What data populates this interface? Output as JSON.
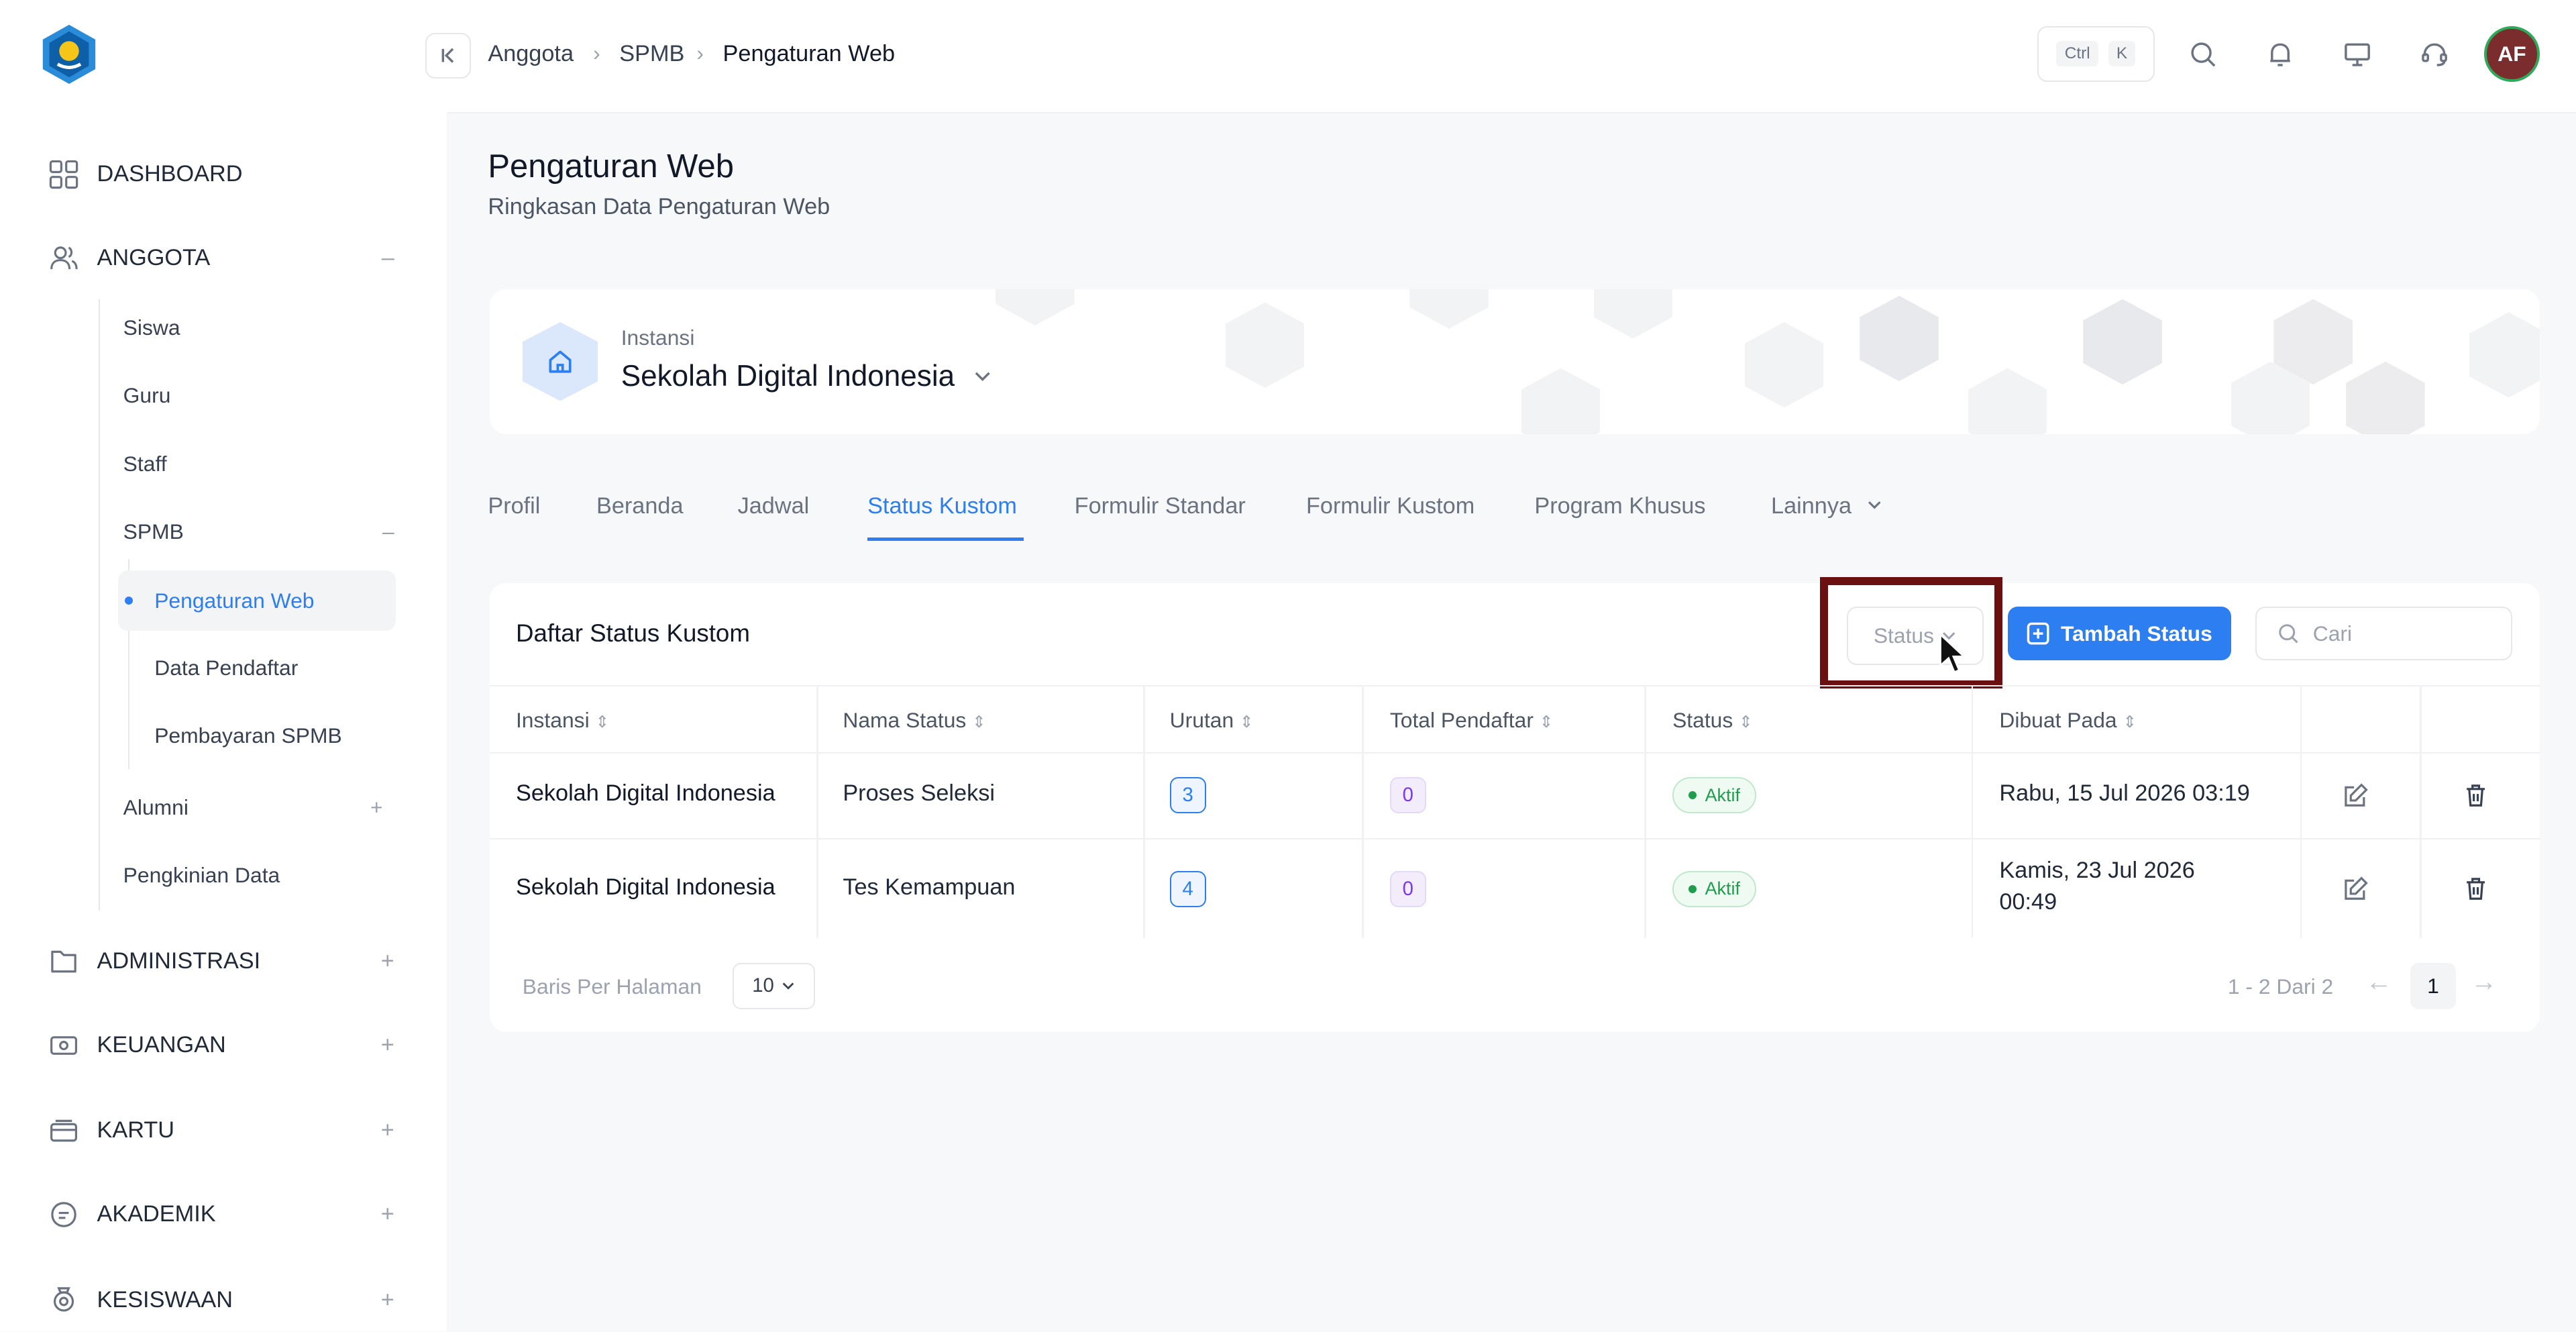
{
  "breadcrumb": [
    "Anggota",
    "SPMB",
    "Pengaturan Web"
  ],
  "topbar": {
    "kbd_ctrl": "Ctrl",
    "kbd_k": "K",
    "avatar_initials": "AF",
    "avatar_color": "#7b2c2c"
  },
  "sidebar": {
    "items": [
      {
        "label": "DASHBOARD",
        "icon": "grid-icon"
      },
      {
        "label": "ANGGOTA",
        "icon": "users-icon",
        "toggle": "–"
      },
      {
        "label": "ADMINISTRASI",
        "icon": "folder-icon",
        "toggle": "+"
      },
      {
        "label": "KEUANGAN",
        "icon": "money-icon",
        "toggle": "+"
      },
      {
        "label": "KARTU",
        "icon": "card-icon",
        "toggle": "+"
      },
      {
        "label": "AKADEMIK",
        "icon": "book-icon",
        "toggle": "+"
      },
      {
        "label": "KESISWAAN",
        "icon": "badge-icon",
        "toggle": "+"
      }
    ],
    "anggota_sub": [
      "Siswa",
      "Guru",
      "Staff",
      "SPMB",
      "Alumni",
      "Pengkinian Data"
    ],
    "spmb_toggle": "–",
    "alumni_toggle": "+",
    "spmb_sub": [
      "Pengaturan Web",
      "Data Pendaftar",
      "Pembayaran SPMB"
    ]
  },
  "page": {
    "title": "Pengaturan Web",
    "subtitle": "Ringkasan Data Pengaturan Web"
  },
  "instansi": {
    "label": "Instansi",
    "name": "Sekolah Digital Indonesia"
  },
  "tabs": [
    "Profil",
    "Beranda",
    "Jadwal",
    "Status Kustom",
    "Formulir Standar",
    "Formulir Kustom",
    "Program Khusus",
    "Lainnya"
  ],
  "active_tab": "Status Kustom",
  "accent_color": "#2d7ef0",
  "table_card": {
    "title": "Daftar Status Kustom",
    "status_filter": "Status",
    "add_button": "Tambah Status",
    "search_placeholder": "Cari",
    "columns": [
      "Instansi",
      "Nama Status",
      "Urutan",
      "Total Pendaftar",
      "Status",
      "Dibuat Pada"
    ],
    "rows": [
      {
        "instansi": "Sekolah Digital Indonesia",
        "nama": "Proses Seleksi",
        "urutan": "3",
        "total": "0",
        "status": "Aktif",
        "dibuat_1": "Rabu, 15 Jul 2026 03:19",
        "dibuat_2": ""
      },
      {
        "instansi": "Sekolah Digital Indonesia",
        "nama": "Tes Kemampuan",
        "urutan": "4",
        "total": "0",
        "status": "Aktif",
        "dibuat_1": "Kamis, 23 Jul 2026",
        "dibuat_2": "00:49"
      }
    ],
    "per_page_label": "Baris Per Halaman",
    "per_page": "10",
    "page_info": "1 - 2 Dari 2",
    "current_page": "1",
    "prev": "←",
    "next": "→"
  }
}
